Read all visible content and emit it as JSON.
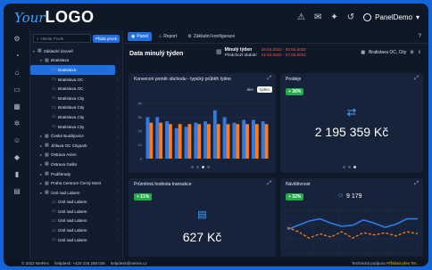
{
  "logo": {
    "prefix": "Your",
    "main": "LOGO"
  },
  "topbar": {
    "icons": [
      "bullhorn-icon",
      "megaphone-icon",
      "bell-icon",
      "history-icon"
    ],
    "user": "PanelDemo"
  },
  "rail": [
    "gear-icon",
    "gauge-icon",
    "store-icon",
    "chart-icon",
    "table-icon",
    "cogs-icon",
    "user-icon",
    "tag-icon",
    "bar-chart-icon",
    "basket-icon"
  ],
  "tree": {
    "search_placeholder": "Hledat Prvek",
    "add_button": "Přidat prvek",
    "nodes": [
      {
        "label": "Základní úroveň",
        "level": 0,
        "arrow": "▾",
        "icon": "▦"
      },
      {
        "label": "Bratislava",
        "level": 1,
        "arrow": "▾",
        "icon": "▦"
      },
      {
        "label": "Bratislava",
        "level": 2,
        "arrow": "",
        "icon": "▭",
        "selected": true
      },
      {
        "label": "Bratislava OC",
        "level": 2,
        "arrow": "",
        "icon": "▭"
      },
      {
        "label": "Bratislava OC",
        "level": 2,
        "arrow": "",
        "icon": "▭"
      },
      {
        "label": "Bratislava City",
        "level": 2,
        "arrow": "",
        "icon": "▭"
      },
      {
        "label": "Bratislava City",
        "level": 2,
        "arrow": "",
        "icon": "▭"
      },
      {
        "label": "Bratislava City",
        "level": 2,
        "arrow": "",
        "icon": "▭"
      },
      {
        "label": "Bratislava City",
        "level": 2,
        "arrow": "",
        "icon": "▭"
      },
      {
        "label": "České Budějovice",
        "level": 1,
        "arrow": "▸",
        "icon": "▦"
      },
      {
        "label": "Jihlava OC Citypark",
        "level": 1,
        "arrow": "▸",
        "icon": "▦"
      },
      {
        "label": "Ostrava Avion",
        "level": 1,
        "arrow": "▸",
        "icon": "▦"
      },
      {
        "label": "Ostrava Galko",
        "level": 1,
        "arrow": "▸",
        "icon": "▦"
      },
      {
        "label": "Poděbrady",
        "level": 1,
        "arrow": "▸",
        "icon": "▦"
      },
      {
        "label": "Praha Centrum Černý Most",
        "level": 1,
        "arrow": "▸",
        "icon": "▦"
      },
      {
        "label": "Ústí nad Labem",
        "level": 1,
        "arrow": "▾",
        "icon": "▦"
      },
      {
        "label": "Ústí nad Labem",
        "level": 2,
        "arrow": "",
        "icon": "▭"
      },
      {
        "label": "Ústí nad Labem",
        "level": 2,
        "arrow": "",
        "icon": "▭"
      },
      {
        "label": "Ústí nad Labem",
        "level": 2,
        "arrow": "",
        "icon": "▭"
      },
      {
        "label": "Ústí nad Labem",
        "level": 2,
        "arrow": "",
        "icon": "▭"
      },
      {
        "label": "Ústí nad Labem",
        "level": 2,
        "arrow": "",
        "icon": "▭"
      }
    ]
  },
  "tabs": [
    {
      "label": "Panel",
      "icon": "◉",
      "active": true
    },
    {
      "label": "Report",
      "icon": "⌂",
      "active": false
    },
    {
      "label": "Základní konfigurace",
      "icon": "⚙",
      "active": false
    }
  ],
  "header": {
    "title": "Data minulý týden",
    "period_label": "Minulý týden",
    "previous_label": "Předchozí období",
    "period_dates": "28.03.2022 - 03.04.2022",
    "previous_dates": "21.03.2022 - 27.03.2022",
    "location": "Bratislava OC, City"
  },
  "cards": {
    "conversion": {
      "title": "Konverzní poměr obchodu - typický průběh týdne",
      "toggle": [
        "den",
        "týden"
      ]
    },
    "sales": {
      "title": "Prodeje",
      "badge": "+ 36%",
      "value": "2 195 359 Kč"
    },
    "avg": {
      "title": "Průměrná hodnota transakce",
      "badge": "+ 11%",
      "value": "627 Kč"
    },
    "visits": {
      "title": "Návštěvnost",
      "badge": "+ 32%",
      "value": "9 179"
    }
  },
  "footer": {
    "copyright": "© 2022 NetRex",
    "phone": "helpdesk: +420 226 258 026",
    "email": "helpdesk@netrex.cz",
    "support": "Technická podpora",
    "support_link": "Přihlásit přes Ter..."
  },
  "colors": {
    "accent": "#1f6fe0",
    "orange": "#ff7a1a",
    "blue": "#2f7ae5",
    "green": "#1fae4a"
  },
  "chart_data": [
    {
      "type": "bar",
      "categories": [
        "Po",
        "Út",
        "St",
        "Čt",
        "Pá",
        "So",
        "Ne",
        "",
        "",
        "",
        "",
        "",
        ""
      ],
      "series": [
        {
          "values": [
            30,
            30,
            27,
            22,
            23,
            26,
            27,
            35,
            30,
            26,
            28,
            28,
            27
          ]
        },
        {
          "values": [
            26,
            26,
            25,
            25,
            25,
            25,
            25,
            25,
            25,
            25,
            25,
            25,
            25
          ]
        }
      ],
      "ylim": [
        0,
        40
      ],
      "ytick_labels": [
        "40",
        "30",
        "20",
        "10",
        "0"
      ],
      "xtick_labels": [
        "",
        "",
        "",
        "",
        "",
        ""
      ]
    },
    {
      "type": "line",
      "ylim": [
        0,
        40
      ],
      "series": [
        {
          "values": [
            22,
            26,
            30,
            32,
            28,
            25,
            26,
            31,
            28,
            24,
            27,
            32,
            32
          ]
        },
        {
          "values": [
            24,
            20,
            14,
            18,
            15,
            20,
            14,
            19,
            17,
            19,
            16,
            20,
            18
          ]
        }
      ]
    }
  ]
}
